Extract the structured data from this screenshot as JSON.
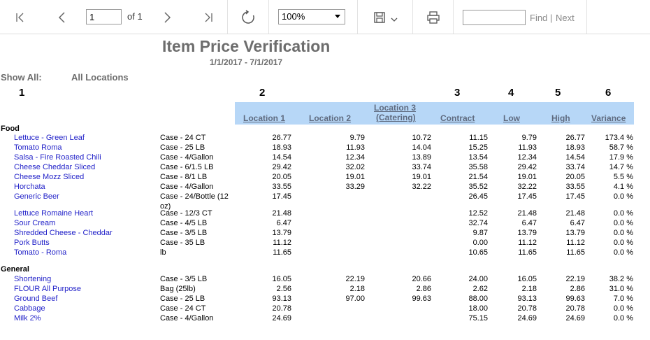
{
  "toolbar": {
    "page_value": "1",
    "page_of": "of 1",
    "zoom": "100%",
    "find_placeholder": "",
    "find_label": "Find",
    "find_separator": "|",
    "next_label": "Next"
  },
  "report": {
    "title": "Item Price Verification",
    "date_range": "1/1/2017 - 7/1/2017",
    "show_all_label": "Show All:",
    "show_all_value": "All Locations",
    "column_numbers": [
      "1",
      "2",
      "3",
      "4",
      "5",
      "6"
    ],
    "headers": {
      "location1": "Location 1",
      "location2": "Location 2",
      "location3_line1": "Location 3",
      "location3_line2": "(Catering)",
      "contract": "Contract",
      "low": "Low",
      "high": "High",
      "variance": "Variance"
    },
    "groups": [
      {
        "name": "Food",
        "rows": [
          {
            "item": "Lettuce - Green Leaf",
            "pack": "Case - 24 CT",
            "loc1": "26.77",
            "loc2": "9.79",
            "loc3": "10.72",
            "contract": "11.15",
            "low": "9.79",
            "high": "26.77",
            "variance": "173.4 %"
          },
          {
            "item": "Tomato Roma",
            "pack": "Case - 25 LB",
            "loc1": "18.93",
            "loc2": "11.93",
            "loc3": "14.04",
            "contract": "15.25",
            "low": "11.93",
            "high": "18.93",
            "variance": "58.7 %"
          },
          {
            "item": "Salsa - Fire Roasted Chili",
            "pack": "Case - 4/Gallon",
            "loc1": "14.54",
            "loc2": "12.34",
            "loc3": "13.89",
            "contract": "13.54",
            "low": "12.34",
            "high": "14.54",
            "variance": "17.9 %"
          },
          {
            "item": "Cheese Cheddar Sliced",
            "pack": "Case - 6/1.5 LB",
            "loc1": "29.42",
            "loc2": "32.02",
            "loc3": "33.74",
            "contract": "35.58",
            "low": "29.42",
            "high": "33.74",
            "variance": "14.7 %"
          },
          {
            "item": "Cheese Mozz Sliced",
            "pack": "Case - 8/1 LB",
            "loc1": "20.05",
            "loc2": "19.01",
            "loc3": "19.01",
            "contract": "21.54",
            "low": "19.01",
            "high": "20.05",
            "variance": "5.5 %"
          },
          {
            "item": "Horchata",
            "pack": "Case - 4/Gallon",
            "loc1": "33.55",
            "loc2": "33.29",
            "loc3": "32.22",
            "contract": "35.52",
            "low": "32.22",
            "high": "33.55",
            "variance": "4.1 %"
          },
          {
            "item": "Generic Beer",
            "pack": "Case - 24/Bottle (12",
            "pack2": "oz)",
            "loc1": "17.45",
            "loc2": "",
            "loc3": "",
            "contract": "26.45",
            "low": "17.45",
            "high": "17.45",
            "variance": "0.0 %"
          },
          {
            "item": "Lettuce Romaine Heart",
            "pack": "Case - 12/3 CT",
            "loc1": "21.48",
            "loc2": "",
            "loc3": "",
            "contract": "12.52",
            "low": "21.48",
            "high": "21.48",
            "variance": "0.0 %"
          },
          {
            "item": "Sour Cream",
            "pack": "Case - 4/5 LB",
            "loc1": "6.47",
            "loc2": "",
            "loc3": "",
            "contract": "32.74",
            "low": "6.47",
            "high": "6.47",
            "variance": "0.0 %"
          },
          {
            "item": "Shredded Cheese - Cheddar",
            "pack": "Case - 3/5 LB",
            "loc1": "13.79",
            "loc2": "",
            "loc3": "",
            "contract": "9.87",
            "low": "13.79",
            "high": "13.79",
            "variance": "0.0 %"
          },
          {
            "item": "Pork Butts",
            "pack": "Case - 35 LB",
            "loc1": "11.12",
            "loc2": "",
            "loc3": "",
            "contract": "0.00",
            "low": "11.12",
            "high": "11.12",
            "variance": "0.0 %"
          },
          {
            "item": "Tomato - Roma",
            "pack": "lb",
            "loc1": "11.65",
            "loc2": "",
            "loc3": "",
            "contract": "10.65",
            "low": "11.65",
            "high": "11.65",
            "variance": "0.0 %"
          }
        ]
      },
      {
        "name": "General",
        "rows": [
          {
            "item": "Shortening",
            "pack": "Case - 3/5 LB",
            "loc1": "16.05",
            "loc2": "22.19",
            "loc3": "20.66",
            "contract": "24.00",
            "low": "16.05",
            "high": "22.19",
            "variance": "38.2 %"
          },
          {
            "item": "FLOUR All Purpose",
            "pack": "Bag (25lb)",
            "loc1": "2.56",
            "loc2": "2.18",
            "loc3": "2.86",
            "contract": "2.62",
            "low": "2.18",
            "high": "2.86",
            "variance": "31.0 %"
          },
          {
            "item": "Ground Beef",
            "pack": "Case - 25 LB",
            "loc1": "93.13",
            "loc2": "97.00",
            "loc3": "99.63",
            "contract": "88.00",
            "low": "93.13",
            "high": "99.63",
            "variance": "7.0 %"
          },
          {
            "item": "Cabbage",
            "pack": "Case - 24 CT",
            "loc1": "20.78",
            "loc2": "",
            "loc3": "",
            "contract": "18.00",
            "low": "20.78",
            "high": "20.78",
            "variance": "0.0 %"
          },
          {
            "item": "Milk 2%",
            "pack": "Case - 4/Gallon",
            "loc1": "24.69",
            "loc2": "",
            "loc3": "",
            "contract": "75.15",
            "low": "24.69",
            "high": "24.69",
            "variance": "0.0 %"
          }
        ]
      }
    ]
  }
}
